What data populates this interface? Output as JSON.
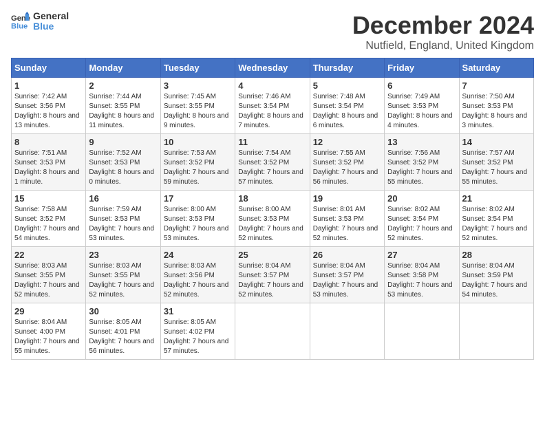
{
  "logo": {
    "line1": "General",
    "line2": "Blue"
  },
  "header": {
    "month_year": "December 2024",
    "location": "Nutfield, England, United Kingdom"
  },
  "days_of_week": [
    "Sunday",
    "Monday",
    "Tuesday",
    "Wednesday",
    "Thursday",
    "Friday",
    "Saturday"
  ],
  "weeks": [
    [
      {
        "day": "1",
        "sunrise": "7:42 AM",
        "sunset": "3:56 PM",
        "daylight": "8 hours and 13 minutes."
      },
      {
        "day": "2",
        "sunrise": "7:44 AM",
        "sunset": "3:55 PM",
        "daylight": "8 hours and 11 minutes."
      },
      {
        "day": "3",
        "sunrise": "7:45 AM",
        "sunset": "3:55 PM",
        "daylight": "8 hours and 9 minutes."
      },
      {
        "day": "4",
        "sunrise": "7:46 AM",
        "sunset": "3:54 PM",
        "daylight": "8 hours and 7 minutes."
      },
      {
        "day": "5",
        "sunrise": "7:48 AM",
        "sunset": "3:54 PM",
        "daylight": "8 hours and 6 minutes."
      },
      {
        "day": "6",
        "sunrise": "7:49 AM",
        "sunset": "3:53 PM",
        "daylight": "8 hours and 4 minutes."
      },
      {
        "day": "7",
        "sunrise": "7:50 AM",
        "sunset": "3:53 PM",
        "daylight": "8 hours and 3 minutes."
      }
    ],
    [
      {
        "day": "8",
        "sunrise": "7:51 AM",
        "sunset": "3:53 PM",
        "daylight": "8 hours and 1 minute."
      },
      {
        "day": "9",
        "sunrise": "7:52 AM",
        "sunset": "3:53 PM",
        "daylight": "8 hours and 0 minutes."
      },
      {
        "day": "10",
        "sunrise": "7:53 AM",
        "sunset": "3:52 PM",
        "daylight": "7 hours and 59 minutes."
      },
      {
        "day": "11",
        "sunrise": "7:54 AM",
        "sunset": "3:52 PM",
        "daylight": "7 hours and 57 minutes."
      },
      {
        "day": "12",
        "sunrise": "7:55 AM",
        "sunset": "3:52 PM",
        "daylight": "7 hours and 56 minutes."
      },
      {
        "day": "13",
        "sunrise": "7:56 AM",
        "sunset": "3:52 PM",
        "daylight": "7 hours and 55 minutes."
      },
      {
        "day": "14",
        "sunrise": "7:57 AM",
        "sunset": "3:52 PM",
        "daylight": "7 hours and 55 minutes."
      }
    ],
    [
      {
        "day": "15",
        "sunrise": "7:58 AM",
        "sunset": "3:52 PM",
        "daylight": "7 hours and 54 minutes."
      },
      {
        "day": "16",
        "sunrise": "7:59 AM",
        "sunset": "3:53 PM",
        "daylight": "7 hours and 53 minutes."
      },
      {
        "day": "17",
        "sunrise": "8:00 AM",
        "sunset": "3:53 PM",
        "daylight": "7 hours and 53 minutes."
      },
      {
        "day": "18",
        "sunrise": "8:00 AM",
        "sunset": "3:53 PM",
        "daylight": "7 hours and 52 minutes."
      },
      {
        "day": "19",
        "sunrise": "8:01 AM",
        "sunset": "3:53 PM",
        "daylight": "7 hours and 52 minutes."
      },
      {
        "day": "20",
        "sunrise": "8:02 AM",
        "sunset": "3:54 PM",
        "daylight": "7 hours and 52 minutes."
      },
      {
        "day": "21",
        "sunrise": "8:02 AM",
        "sunset": "3:54 PM",
        "daylight": "7 hours and 52 minutes."
      }
    ],
    [
      {
        "day": "22",
        "sunrise": "8:03 AM",
        "sunset": "3:55 PM",
        "daylight": "7 hours and 52 minutes."
      },
      {
        "day": "23",
        "sunrise": "8:03 AM",
        "sunset": "3:55 PM",
        "daylight": "7 hours and 52 minutes."
      },
      {
        "day": "24",
        "sunrise": "8:03 AM",
        "sunset": "3:56 PM",
        "daylight": "7 hours and 52 minutes."
      },
      {
        "day": "25",
        "sunrise": "8:04 AM",
        "sunset": "3:57 PM",
        "daylight": "7 hours and 52 minutes."
      },
      {
        "day": "26",
        "sunrise": "8:04 AM",
        "sunset": "3:57 PM",
        "daylight": "7 hours and 53 minutes."
      },
      {
        "day": "27",
        "sunrise": "8:04 AM",
        "sunset": "3:58 PM",
        "daylight": "7 hours and 53 minutes."
      },
      {
        "day": "28",
        "sunrise": "8:04 AM",
        "sunset": "3:59 PM",
        "daylight": "7 hours and 54 minutes."
      }
    ],
    [
      {
        "day": "29",
        "sunrise": "8:04 AM",
        "sunset": "4:00 PM",
        "daylight": "7 hours and 55 minutes."
      },
      {
        "day": "30",
        "sunrise": "8:05 AM",
        "sunset": "4:01 PM",
        "daylight": "7 hours and 56 minutes."
      },
      {
        "day": "31",
        "sunrise": "8:05 AM",
        "sunset": "4:02 PM",
        "daylight": "7 hours and 57 minutes."
      },
      null,
      null,
      null,
      null
    ]
  ]
}
